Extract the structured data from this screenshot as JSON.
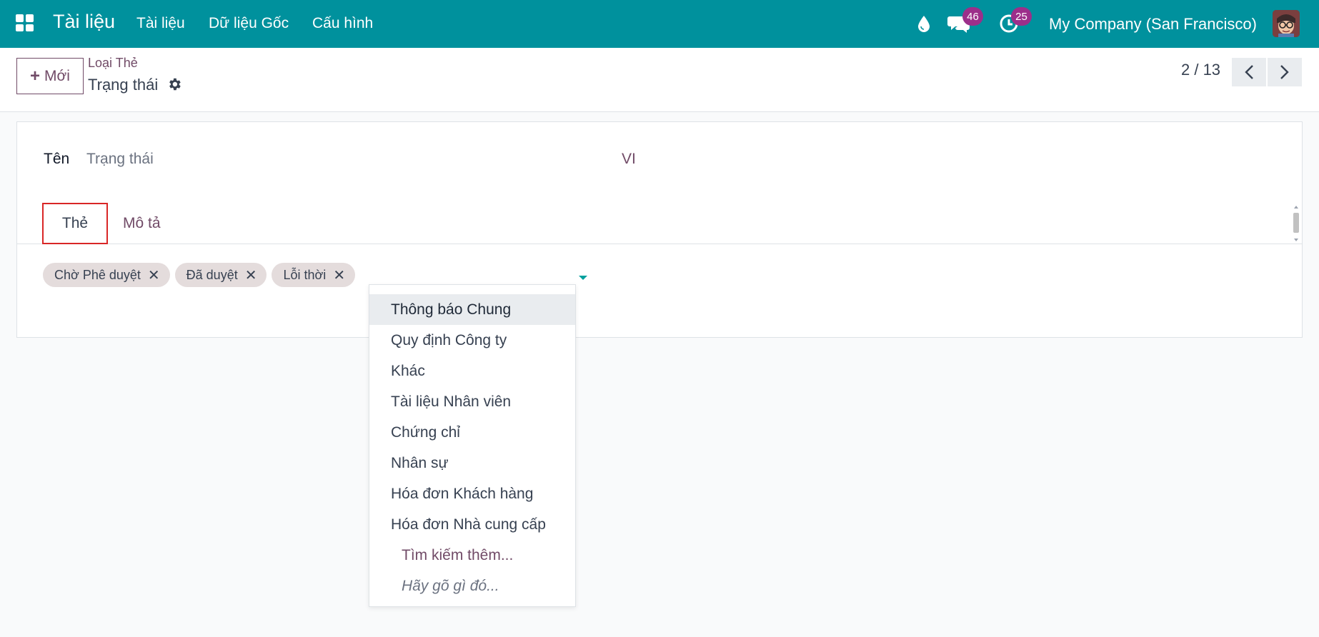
{
  "navbar": {
    "brand": "Tài liệu",
    "menu": [
      "Tài liệu",
      "Dữ liệu Gốc",
      "Cấu hình"
    ],
    "messages_count": "46",
    "activities_count": "25",
    "company": "My Company (San Francisco)",
    "bg_color": "#00919d"
  },
  "control": {
    "new_button": "Mới",
    "breadcrumb_parent": "Loại Thẻ",
    "breadcrumb_current": "Trạng thái",
    "pager": "2 / 13"
  },
  "form": {
    "name_label": "Tên",
    "name_value": "Trạng thái",
    "lang": "VI",
    "tabs": [
      "Thẻ",
      "Mô tả"
    ],
    "tags": [
      "Chờ Phê duyệt",
      "Đã duyệt",
      "Lỗi thời"
    ]
  },
  "dropdown": {
    "items": [
      "Thông báo Chung",
      "Quy định Công ty",
      "Khác",
      "Tài liệu Nhân viên",
      "Chứng chỉ",
      "Nhân sự",
      "Hóa đơn Khách hàng",
      "Hóa đơn Nhà cung cấp"
    ],
    "search_more": "Tìm kiếm thêm...",
    "hint": "Hãy gõ gì đó..."
  },
  "colors": {
    "accent": "#714b67",
    "badge": "#9c2f8a",
    "highlight_border": "#d92626"
  }
}
